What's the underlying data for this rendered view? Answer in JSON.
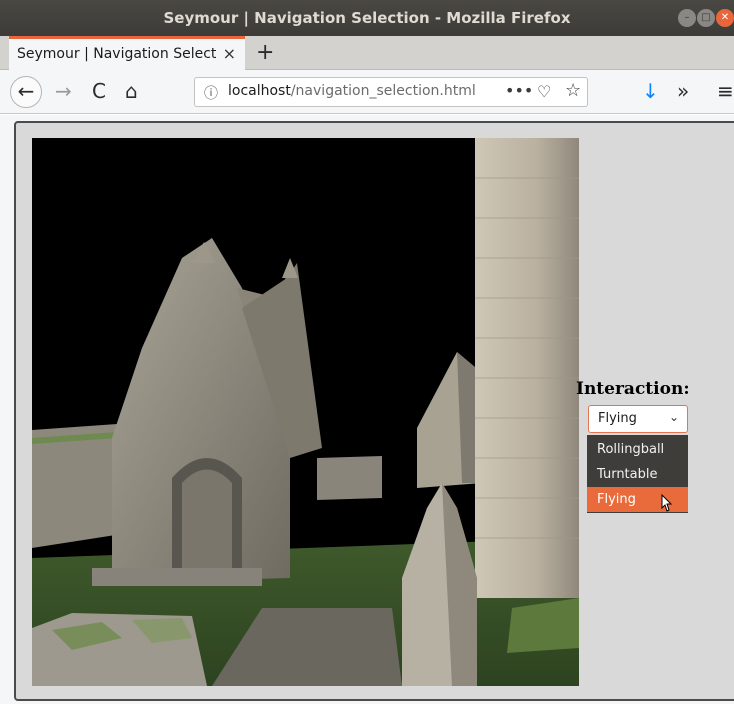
{
  "window": {
    "title": "Seymour | Navigation Selection - Mozilla Firefox"
  },
  "tab": {
    "label": "Seymour | Navigation Selection",
    "close_icon": "×",
    "new_tab_icon": "+"
  },
  "navbar": {
    "back_icon": "←",
    "forward_icon": "→",
    "reload_icon": "C",
    "home_icon": "⌂",
    "info_icon": "ⓘ",
    "url_host": "localhost",
    "url_path": "/navigation_selection.html",
    "page_actions_icon": "•••",
    "pocket_icon": "♡",
    "bookmark_icon": "☆",
    "download_icon": "↓",
    "overflow_icon": "»",
    "menu_icon": "≡"
  },
  "page": {
    "interaction_label": "Interaction:",
    "select": {
      "value": "Flying",
      "options": [
        "Rollingball",
        "Turntable",
        "Flying"
      ],
      "selected_index": 2
    }
  },
  "colors": {
    "accent": "#e96b3c",
    "titlebar": "#3c3b37",
    "dropdown": "#3f3d39"
  }
}
